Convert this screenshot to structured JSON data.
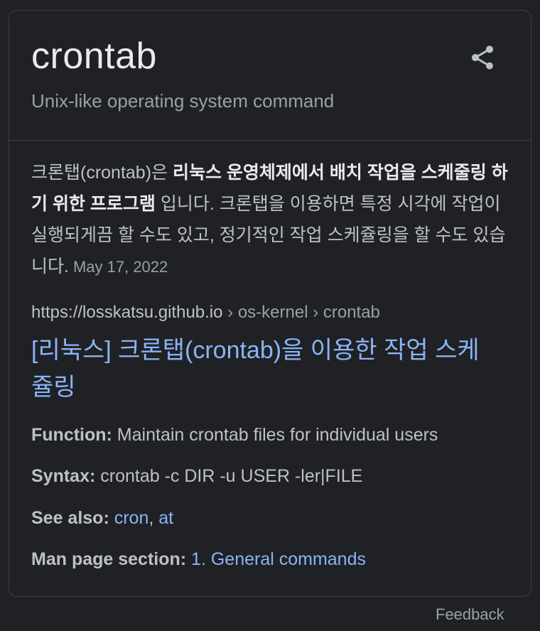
{
  "header": {
    "title": "crontab",
    "subtitle": "Unix-like operating system command",
    "share_icon": "share-icon"
  },
  "description": {
    "text_prefix": "크론탭(crontab)은 ",
    "text_bold": "리눅스 운영체제에서 배치 작업을 스케줄링 하기 위한 프로그램",
    "text_suffix": " 입니다. 크론탭을 이용하면 특정 시각에 작업이 실행되게끔 할 수도 있고, 정기적인 작업 스케쥴링을 할 수도 있습니다.",
    "date": "May 17, 2022"
  },
  "source": {
    "domain": "https://losskatsu.github.io",
    "breadcrumb": " › os-kernel › crontab",
    "link_title": "[리눅스] 크론탭(crontab)을 이용한 작업 스케쥴링"
  },
  "facts": {
    "function_label": "Function:",
    "function_value": " Maintain crontab files for individual users",
    "syntax_label": "Syntax:",
    "syntax_value": " crontab -c DIR -u USER -ler|FILE",
    "see_also_label": "See also:",
    "see_also_link1": "cron",
    "see_also_sep": ", ",
    "see_also_link2": "at",
    "man_label": "Man page section:",
    "man_link": "1. General commands"
  },
  "footer": {
    "feedback": "Feedback"
  },
  "colors": {
    "background": "#202124",
    "link": "#8ab4f8",
    "text": "#bdc1c6",
    "muted": "#9aa0a6",
    "border": "#3c4043"
  }
}
